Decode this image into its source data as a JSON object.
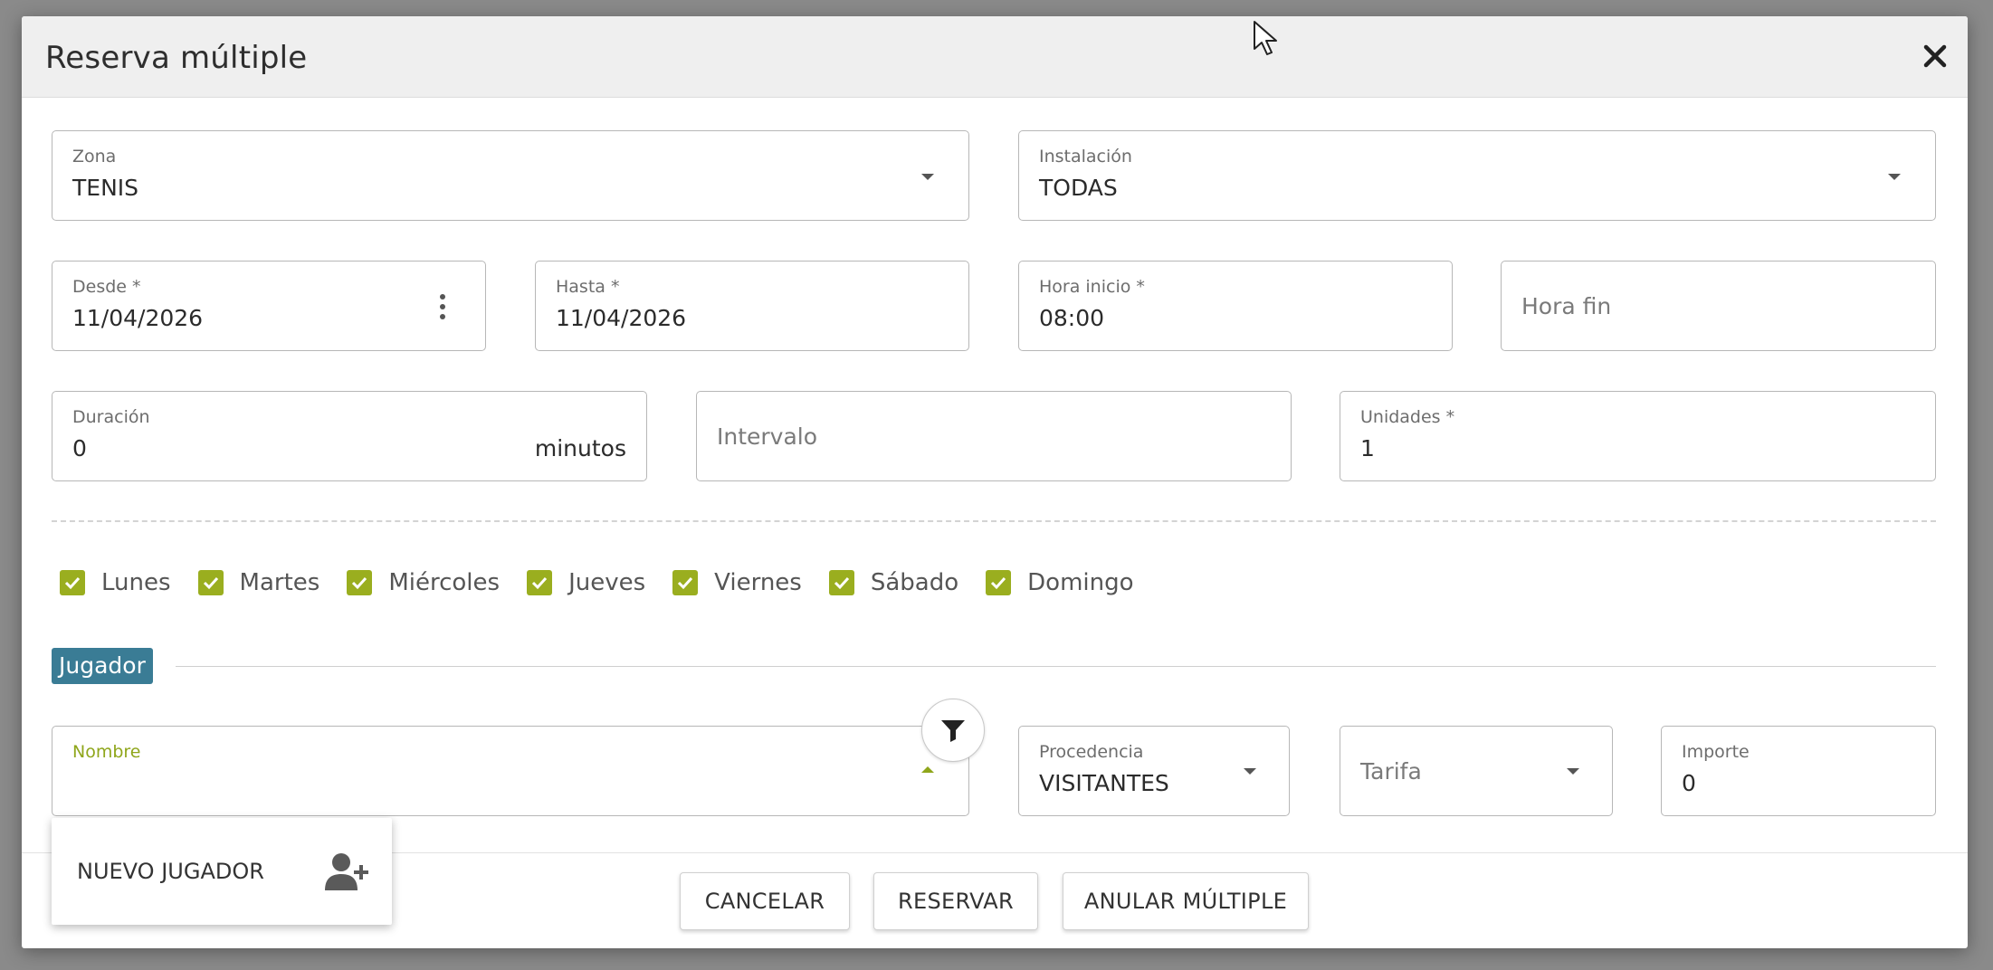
{
  "dialog": {
    "title": "Reserva múltiple",
    "close_glyph": "✕"
  },
  "zona": {
    "label": "Zona",
    "value": "TENIS"
  },
  "instalacion": {
    "label": "Instalación",
    "value": "TODAS"
  },
  "desde": {
    "label": "Desde *",
    "value": "11/04/2026"
  },
  "hasta": {
    "label": "Hasta *",
    "value": "11/04/2026"
  },
  "hora_inicio": {
    "label": "Hora inicio *",
    "value": "08:00"
  },
  "hora_fin": {
    "placeholder": "Hora fin"
  },
  "duracion": {
    "label": "Duración",
    "value": "0",
    "suffix": "minutos"
  },
  "intervalo": {
    "placeholder": "Intervalo"
  },
  "unidades": {
    "label": "Unidades *",
    "value": "1"
  },
  "days": [
    {
      "label": "Lunes",
      "checked": true
    },
    {
      "label": "Martes",
      "checked": true
    },
    {
      "label": "Miércoles",
      "checked": true
    },
    {
      "label": "Jueves",
      "checked": true
    },
    {
      "label": "Viernes",
      "checked": true
    },
    {
      "label": "Sábado",
      "checked": true
    },
    {
      "label": "Domingo",
      "checked": true
    }
  ],
  "section": {
    "title": "Jugador"
  },
  "nombre": {
    "label": "Nombre",
    "value": ""
  },
  "procedencia": {
    "label": "Procedencia",
    "value": "VISITANTES"
  },
  "tarifa": {
    "placeholder": "Tarifa"
  },
  "importe": {
    "label": "Importe",
    "value": "0"
  },
  "dropdown": {
    "item_label": "NUEVO JUGADOR",
    "item_icon": "add-user-icon"
  },
  "footer": {
    "cancel_label": "CANCELAR",
    "reserve_label": "RESERVAR",
    "cancel_multiple_label": "ANULAR MÚLTIPLE"
  },
  "colors": {
    "accent_green": "#9aae1f",
    "section_blue": "#3a7c95",
    "header_bg": "#efefef",
    "backdrop": "#8a8a8a"
  }
}
